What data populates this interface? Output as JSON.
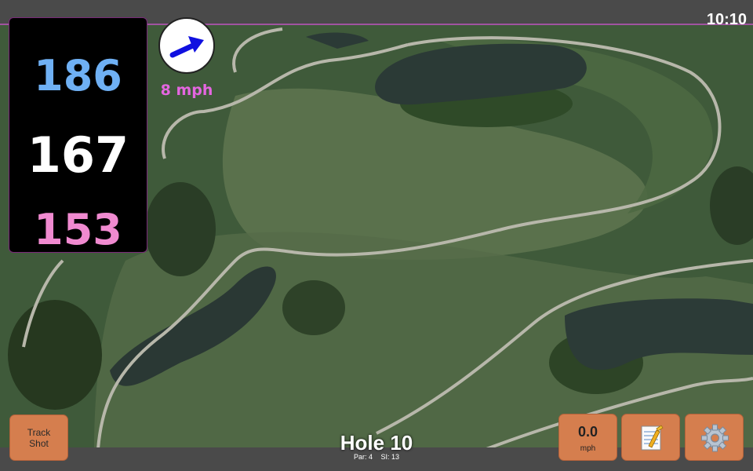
{
  "status": {
    "time": "10:10"
  },
  "yardage": {
    "back": "186",
    "middle": "167",
    "front": "153"
  },
  "wind": {
    "speed": "8 mph",
    "direction_icon": "wind-arrow-icon",
    "arrow_color": "#1010e0"
  },
  "buttons": {
    "track_shot": {
      "line1": "Track",
      "line2": "Shot"
    },
    "speed": {
      "value": "0.0",
      "unit": "mph"
    },
    "notes_icon": "notepad-icon",
    "settings_icon": "gear-icon"
  },
  "hole": {
    "title": "Hole 10",
    "par": "Par: 4",
    "si": "SI: 13"
  },
  "colors": {
    "accent_button": "#d57e4e",
    "back": "#6fb0f4",
    "front": "#f08ad0",
    "wind_text": "#e466e0"
  }
}
